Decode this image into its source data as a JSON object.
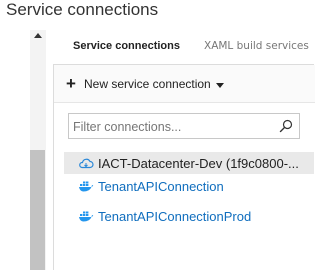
{
  "page": {
    "title": "Service connections"
  },
  "tabs": [
    {
      "label": "Service connections",
      "active": true
    },
    {
      "label": "XAML build services",
      "active": false
    }
  ],
  "toolbar": {
    "new_button_label": "New service connection"
  },
  "filter": {
    "placeholder": "Filter connections..."
  },
  "connections": [
    {
      "label": "IACT-Datacenter-Dev (1f9c0800-...",
      "icon": "azure-cloud-icon",
      "selected": true
    },
    {
      "label": "TenantAPIConnection",
      "icon": "docker-icon",
      "selected": false
    },
    {
      "label": "TenantAPIConnectionProd",
      "icon": "docker-icon",
      "selected": false
    }
  ],
  "colors": {
    "link": "#106ebe",
    "selection": "#e9e9e9",
    "scroll_thumb": "#c2c2c2"
  }
}
